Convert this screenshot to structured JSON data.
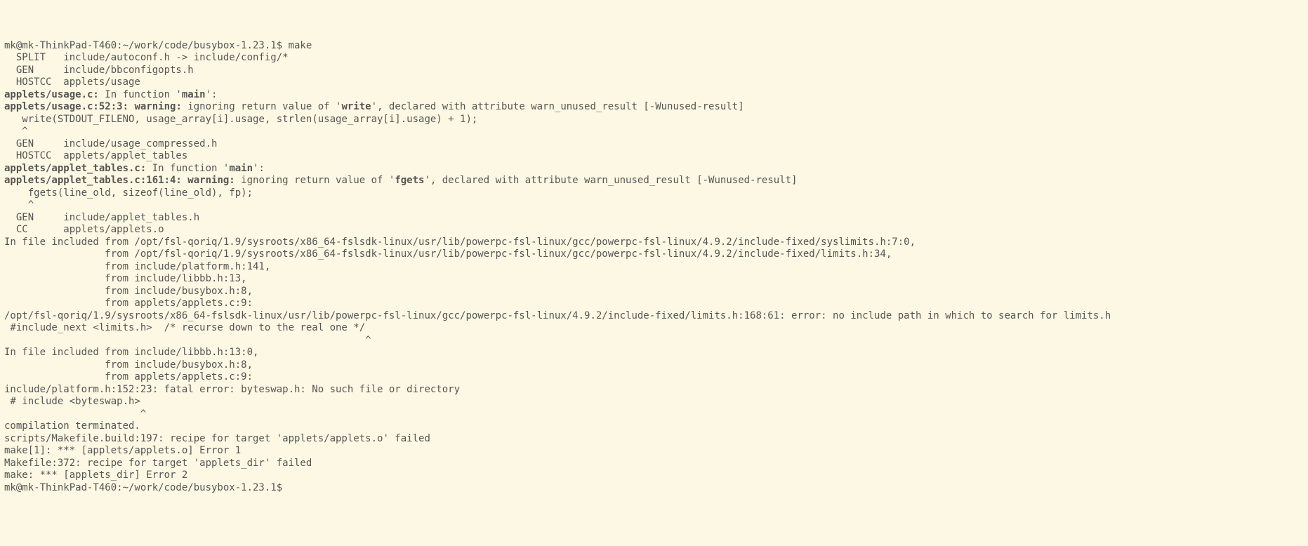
{
  "terminal": {
    "bg": "#fcf8e3",
    "fg": "#555",
    "prompt1": "mk@mk-ThinkPad-T460:~/work/code/busybox-1.23.1$ make",
    "lines": [
      {
        "t": "  SPLIT   include/autoconf.h -> include/config/*"
      },
      {
        "t": "  GEN     include/bbconfigopts.h"
      },
      {
        "t": "  HOSTCC  applets/usage"
      },
      {
        "segments": [
          {
            "t": "applets/usage.c:",
            "b": true
          },
          {
            "t": " In function '"
          },
          {
            "t": "main",
            "b": true
          },
          {
            "t": "':"
          }
        ]
      },
      {
        "segments": [
          {
            "t": "applets/usage.c:52:3: ",
            "b": true
          },
          {
            "t": "warning:",
            "b": true
          },
          {
            "t": " ignoring return value of '"
          },
          {
            "t": "write",
            "b": true
          },
          {
            "t": "', declared with attribute warn_unused_result [-Wunused-result]"
          }
        ]
      },
      {
        "t": "   write(STDOUT_FILENO, usage_array[i].usage, strlen(usage_array[i].usage) + 1);"
      },
      {
        "t": "   ^"
      },
      {
        "t": "  GEN     include/usage_compressed.h"
      },
      {
        "t": "  HOSTCC  applets/applet_tables"
      },
      {
        "segments": [
          {
            "t": "applets/applet_tables.c:",
            "b": true
          },
          {
            "t": " In function '"
          },
          {
            "t": "main",
            "b": true
          },
          {
            "t": "':"
          }
        ]
      },
      {
        "segments": [
          {
            "t": "applets/applet_tables.c:161:4: ",
            "b": true
          },
          {
            "t": "warning:",
            "b": true
          },
          {
            "t": " ignoring return value of '"
          },
          {
            "t": "fgets",
            "b": true
          },
          {
            "t": "', declared with attribute warn_unused_result [-Wunused-result]"
          }
        ]
      },
      {
        "t": "    fgets(line_old, sizeof(line_old), fp);"
      },
      {
        "t": "    ^"
      },
      {
        "t": "  GEN     include/applet_tables.h"
      },
      {
        "t": "  CC      applets/applets.o"
      },
      {
        "t": "In file included from /opt/fsl-qoriq/1.9/sysroots/x86_64-fslsdk-linux/usr/lib/powerpc-fsl-linux/gcc/powerpc-fsl-linux/4.9.2/include-fixed/syslimits.h:7:0,"
      },
      {
        "t": "                 from /opt/fsl-qoriq/1.9/sysroots/x86_64-fslsdk-linux/usr/lib/powerpc-fsl-linux/gcc/powerpc-fsl-linux/4.9.2/include-fixed/limits.h:34,"
      },
      {
        "t": "                 from include/platform.h:141,"
      },
      {
        "t": "                 from include/libbb.h:13,"
      },
      {
        "t": "                 from include/busybox.h:8,"
      },
      {
        "t": "                 from applets/applets.c:9:"
      },
      {
        "t": "/opt/fsl-qoriq/1.9/sysroots/x86_64-fslsdk-linux/usr/lib/powerpc-fsl-linux/gcc/powerpc-fsl-linux/4.9.2/include-fixed/limits.h:168:61: error: no include path in which to search for limits.h"
      },
      {
        "t": " #include_next <limits.h>  /* recurse down to the real one */"
      },
      {
        "t": "                                                             ^"
      },
      {
        "t": "In file included from include/libbb.h:13:0,"
      },
      {
        "t": "                 from include/busybox.h:8,"
      },
      {
        "t": "                 from applets/applets.c:9:"
      },
      {
        "t": "include/platform.h:152:23: fatal error: byteswap.h: No such file or directory"
      },
      {
        "t": " # include <byteswap.h>"
      },
      {
        "t": "                       ^"
      },
      {
        "t": "compilation terminated."
      },
      {
        "t": "scripts/Makefile.build:197: recipe for target 'applets/applets.o' failed"
      },
      {
        "t": "make[1]: *** [applets/applets.o] Error 1"
      },
      {
        "t": "Makefile:372: recipe for target 'applets_dir' failed"
      },
      {
        "t": "make: *** [applets_dir] Error 2"
      }
    ],
    "prompt2": "mk@mk-ThinkPad-T460:~/work/code/busybox-1.23.1$ "
  }
}
